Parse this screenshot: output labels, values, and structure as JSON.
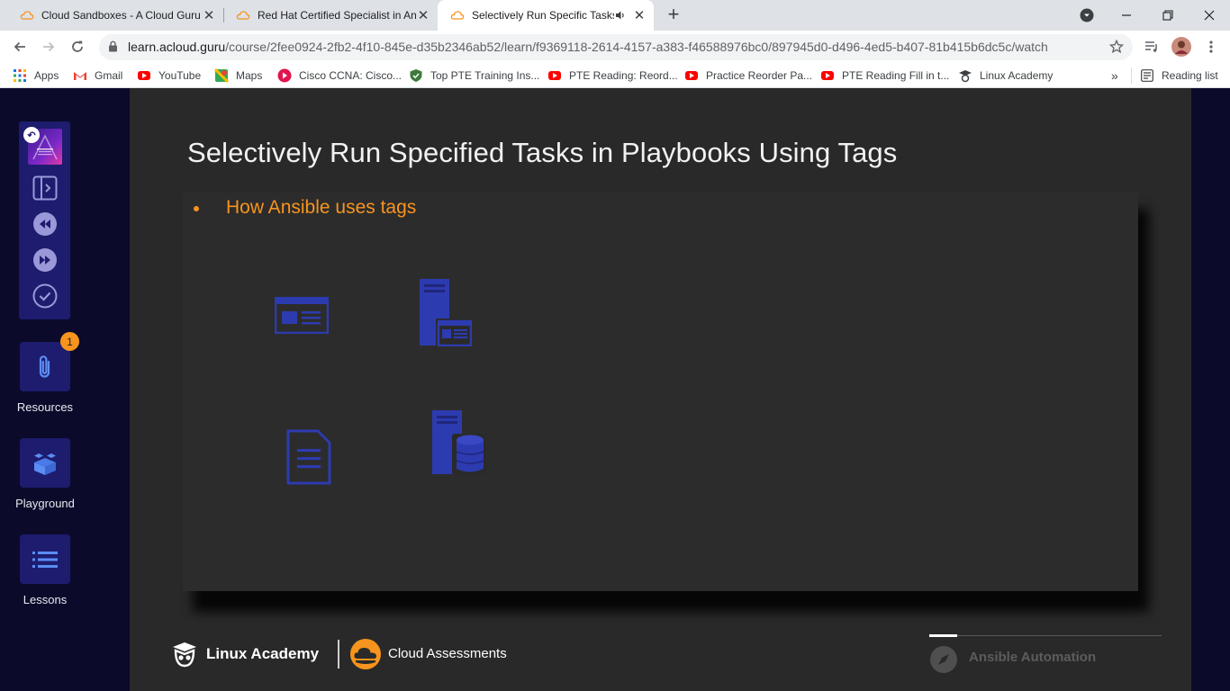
{
  "browser": {
    "tabs": [
      {
        "title": "Cloud Sandboxes - A Cloud Guru",
        "icon": "cloud-favicon-icon",
        "active": false
      },
      {
        "title": "Red Hat Certified Specialist in An",
        "icon": "cloud-favicon-icon",
        "active": false
      },
      {
        "title": "Selectively Run Specific Tasks",
        "icon": "cloud-favicon-icon",
        "active": true,
        "audio": "speaker-icon"
      }
    ],
    "url_host": "learn.acloud.guru",
    "url_path": "/course/2fee0924-2fb2-4f10-845e-d35b2346ab52/learn/f9369118-2614-4157-a383-f46588976bc0/897945d0-d496-4ed5-b407-81b415b6dc5c/watch",
    "bookmarks": [
      {
        "label": "Apps",
        "icon": "apps-grid-icon"
      },
      {
        "label": "Gmail",
        "icon": "gmail-icon"
      },
      {
        "label": "YouTube",
        "icon": "youtube-icon"
      },
      {
        "label": "Maps",
        "icon": "maps-icon"
      },
      {
        "label": "Cisco CCNA: Cisco...",
        "icon": "cisco-icon"
      },
      {
        "label": "Top PTE Training Ins...",
        "icon": "shield-icon"
      },
      {
        "label": "PTE Reading: Reord...",
        "icon": "youtube-icon"
      },
      {
        "label": "Practice Reorder Pa...",
        "icon": "youtube-icon"
      },
      {
        "label": "PTE Reading Fill in t...",
        "icon": "youtube-icon"
      },
      {
        "label": "Linux Academy",
        "icon": "linux-academy-icon"
      }
    ],
    "more_bookmarks": "»",
    "reading_list": "Reading list"
  },
  "sidebar": {
    "resources_label": "Resources",
    "resources_badge": "1",
    "playground_label": "Playground",
    "lessons_label": "Lessons"
  },
  "slide": {
    "title": "Selectively Run Specified Tasks in Playbooks Using Tags",
    "bullet": "How Ansible uses tags",
    "icons": [
      "browser-window-icon",
      "server-window-icon",
      "document-icon",
      "server-database-icon"
    ]
  },
  "footer": {
    "brand": "Linux Academy",
    "brand2": "Cloud Assessments",
    "course_tag": "Ansible Automation",
    "progress": 0.12
  },
  "colors": {
    "accent_orange": "#f7941d",
    "sidebar_navy": "#1e1c6e",
    "icon_blue": "#2d3bb0"
  }
}
